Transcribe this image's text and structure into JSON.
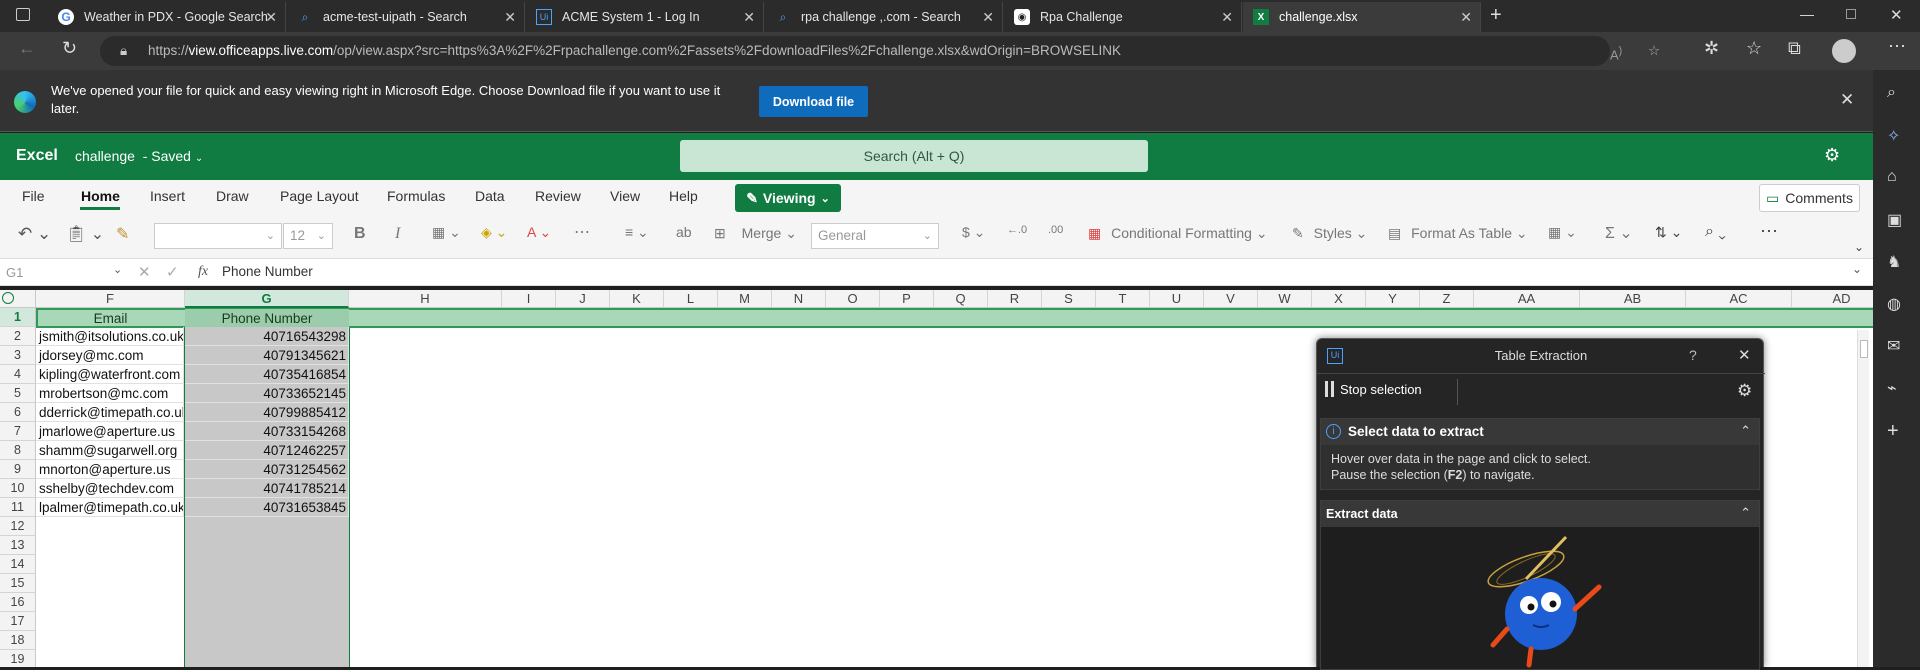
{
  "browser": {
    "tabs": [
      {
        "title": "Weather in PDX - Google Search",
        "icon": "google-icon"
      },
      {
        "title": "acme-test-uipath - Search",
        "icon": "search-icon"
      },
      {
        "title": "ACME System 1 - Log In",
        "icon": "uipath-icon"
      },
      {
        "title": "rpa challenge ,.com - Search",
        "icon": "search-icon"
      },
      {
        "title": "Rpa Challenge",
        "icon": "robot-icon"
      },
      {
        "title": "challenge.xlsx",
        "icon": "excel-icon"
      }
    ],
    "url_prefix": "https://",
    "url_host": "view.officeapps.live.com",
    "url_path": "/op/view.aspx?src=https%3A%2F%2Frpachallenge.com%2Fassets%2FdownloadFiles%2Fchallenge.xlsx&wdOrigin=BROWSELINK"
  },
  "infobar": {
    "message": "We've opened your file for quick and easy viewing right in Microsoft Edge. Choose Download file if you want to use it later.",
    "download_label": "Download file"
  },
  "excel": {
    "app_name": "Excel",
    "file_name": "challenge",
    "saved_status": "- Saved",
    "search_placeholder": "Search (Alt + Q)",
    "ribbon_tabs": [
      "File",
      "Home",
      "Insert",
      "Draw",
      "Page Layout",
      "Formulas",
      "Data",
      "Review",
      "View",
      "Help"
    ],
    "active_tab": "Home",
    "viewing_label": "Viewing",
    "comments_label": "Comments",
    "font_size": "12",
    "merge_label": "Merge",
    "number_format": "General",
    "conditional_formatting": "Conditional Formatting",
    "styles_label": "Styles",
    "format_as_table": "Format As Table",
    "name_box": "G1",
    "fx_label": "fx",
    "formula": "Phone Number"
  },
  "sheet": {
    "columns": [
      "F",
      "G",
      "H",
      "I",
      "J",
      "K",
      "L",
      "M",
      "N",
      "O",
      "P",
      "Q",
      "R",
      "S",
      "T",
      "U",
      "V",
      "W",
      "X",
      "Y",
      "Z",
      "AA",
      "AB",
      "AC",
      "AD"
    ],
    "rows": [
      "1",
      "2",
      "3",
      "4",
      "5",
      "6",
      "7",
      "8",
      "9",
      "10",
      "11",
      "12",
      "13",
      "14",
      "15",
      "16",
      "17",
      "18",
      "19"
    ],
    "header_email": "Email",
    "header_phone": "Phone Number",
    "data": [
      {
        "email": "jsmith@itsolutions.co.uk",
        "phone": "40716543298"
      },
      {
        "email": "jdorsey@mc.com",
        "phone": "40791345621"
      },
      {
        "email": "kipling@waterfront.com",
        "phone": "40735416854"
      },
      {
        "email": "mrobertson@mc.com",
        "phone": "40733652145"
      },
      {
        "email": "dderrick@timepath.co.uk",
        "phone": "40799885412"
      },
      {
        "email": "jmarlowe@aperture.us",
        "phone": "40733154268"
      },
      {
        "email": "shamm@sugarwell.org",
        "phone": "40712462257"
      },
      {
        "email": "mnorton@aperture.us",
        "phone": "40731254562"
      },
      {
        "email": "sshelby@techdev.com",
        "phone": "40741785214"
      },
      {
        "email": "lpalmer@timepath.co.uk",
        "phone": "40731653845"
      }
    ]
  },
  "panel": {
    "title": "Table Extraction",
    "help": "?",
    "stop_label": "Stop selection",
    "section1_title": "Select data to extract",
    "hint_line1": "Hover over data in the page and click to select.",
    "hint_line2_a": "Pause the selection (",
    "hint_line2_key": "F2",
    "hint_line2_b": ") to navigate.",
    "section2_title": "Extract data"
  },
  "colors": {
    "excel_green": "#107c41",
    "selection_green": "#a9d8b8",
    "edge_blue": "#0f6cbd",
    "panel_bg": "#252525"
  }
}
